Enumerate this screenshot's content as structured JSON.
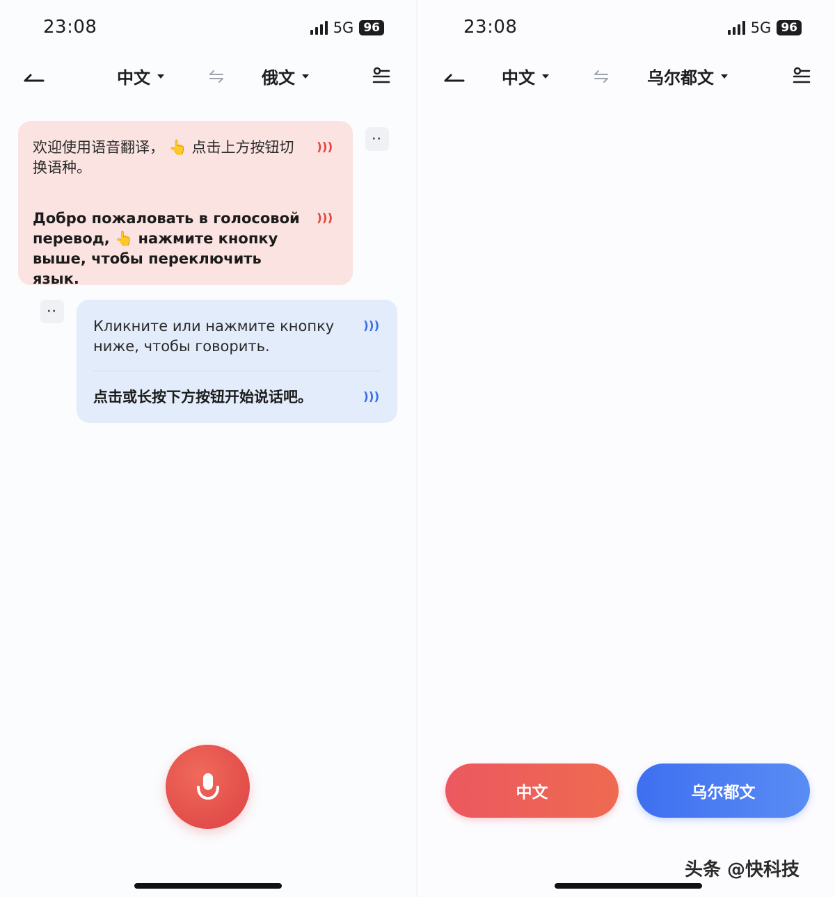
{
  "left_screen": {
    "status": {
      "time": "23:08",
      "network": "5G",
      "battery": "96"
    },
    "nav": {
      "source_lang": "中文",
      "target_lang": "俄文"
    },
    "welcome_bubble": {
      "zh_text_1": "欢迎使用语音翻译，",
      "zh_emoji": "👆",
      "zh_text_2": "点击上方按钮切换语种。",
      "ru_text_1": "Добро пожаловать в голосовой перевод,",
      "ru_emoji": "👆",
      "ru_text_2": "нажмите кнопку выше, чтобы переключить язык.",
      "more": "··"
    },
    "hint_bubble": {
      "ru_text": "Кликните или нажмите кнопку ниже, чтобы говорить.",
      "zh_text": "点击或长按下方按钮开始说话吧。",
      "more": "··"
    },
    "icons": {
      "back": "back-arrow-icon",
      "swap": "swap-icon",
      "settings": "settings-icon",
      "speaker": "speaker-icon",
      "mic": "microphone-icon"
    }
  },
  "right_screen": {
    "status": {
      "time": "23:08",
      "network": "5G",
      "battery": "96"
    },
    "nav": {
      "source_lang": "中文",
      "target_lang": "乌尔都文"
    },
    "buttons": {
      "left_label": "中文",
      "right_label": "乌尔都文"
    }
  },
  "watermark": "头条 @快科技",
  "colors": {
    "pink_bubble": "#fbe3e1",
    "blue_bubble": "#e3ecfb",
    "accent_red": "#e4514c",
    "accent_blue": "#3e6ff0"
  }
}
